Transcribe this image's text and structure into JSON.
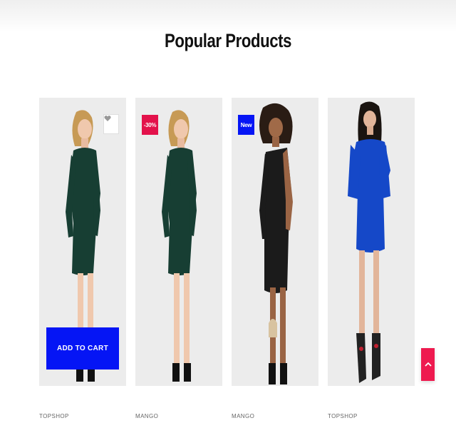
{
  "section": {
    "title": "Popular Products"
  },
  "colors": {
    "accent_blue": "#0515f5",
    "accent_red": "#ee1a4f",
    "photo_bg": "#ececec"
  },
  "products": [
    {
      "brand": "TOPSHOP",
      "dress_color": "#173e33",
      "badge": null,
      "wishlist_icon": "heart-icon",
      "cta": "ADD TO CART"
    },
    {
      "brand": "MANGO",
      "dress_color": "#173e33",
      "badge": {
        "text": "-30%",
        "color": "#e3124b"
      }
    },
    {
      "brand": "MANGO",
      "dress_color": "#1b1b1b",
      "badge": {
        "text": "New",
        "color": "#0515f5"
      }
    },
    {
      "brand": "TOPSHOP",
      "dress_color": "#1548c8",
      "badge": null
    }
  ],
  "scroll_top": {
    "icon": "chevron-up-icon"
  }
}
